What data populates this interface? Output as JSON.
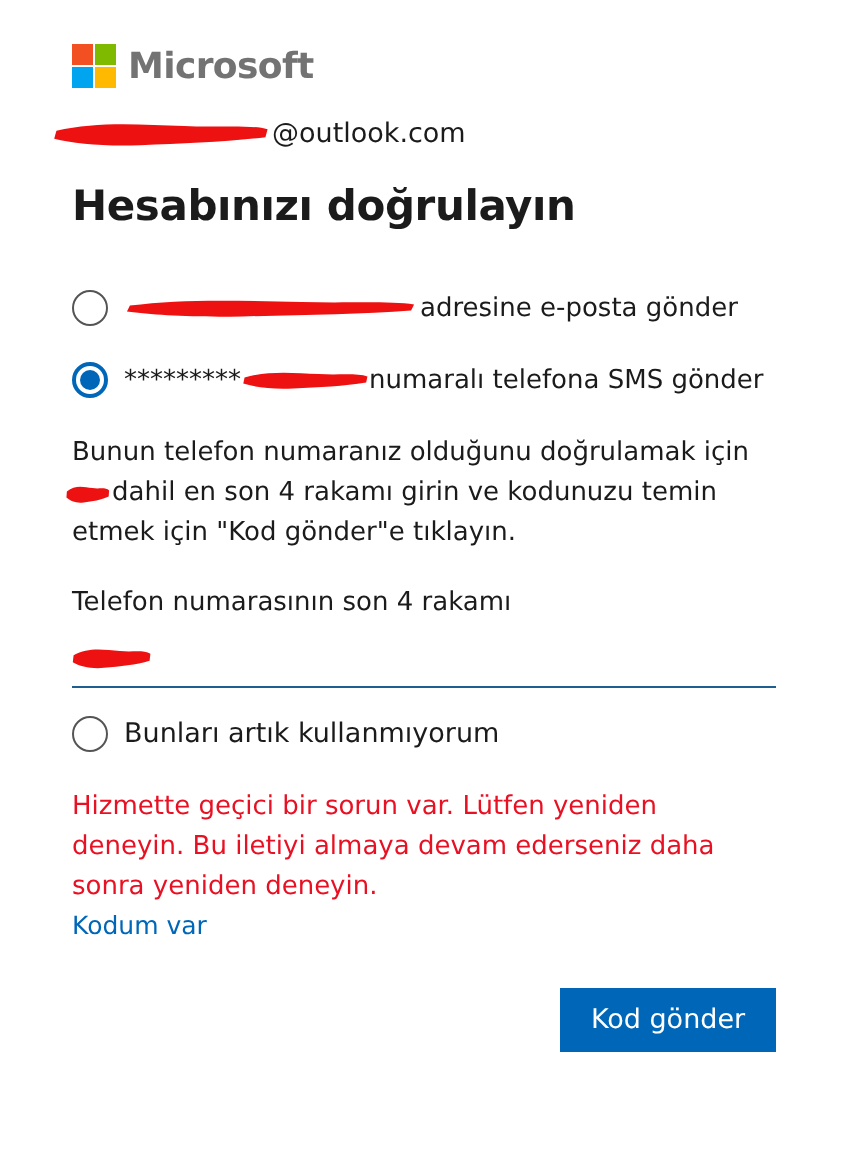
{
  "brand": {
    "name": "Microsoft"
  },
  "account": {
    "redacted": true,
    "email": "@outlook.com"
  },
  "title": "Hesabınızı doğrulayın",
  "options": [
    {
      "selected": false,
      "redacted": true,
      "label": "adresine e-posta gönder"
    },
    {
      "selected": true,
      "prefix": "*********",
      "redacted": true,
      "label": "numaralı telefona SMS gönder"
    }
  ],
  "instructions": {
    "before": "Bunun telefon numaranız olduğunu doğrulamak için",
    "redacted": true,
    "after": "dahil en son 4 rakamı girin ve kodunuzu temin",
    "end": "etmek için \"Kod gönder\"e tıklayın."
  },
  "phone_field": {
    "label": "Telefon numarasının son 4 rakamı",
    "redacted": true
  },
  "fallback_option": {
    "selected": false,
    "label": "Bunları artık kullanmıyorum"
  },
  "error": "Hizmette geçici bir sorun var. Lütfen yeniden deneyin. Bu iletiyi almaya devam ederseniz daha sonra yeniden deneyin.",
  "link": "Kodum var",
  "submit": "Kod gönder"
}
